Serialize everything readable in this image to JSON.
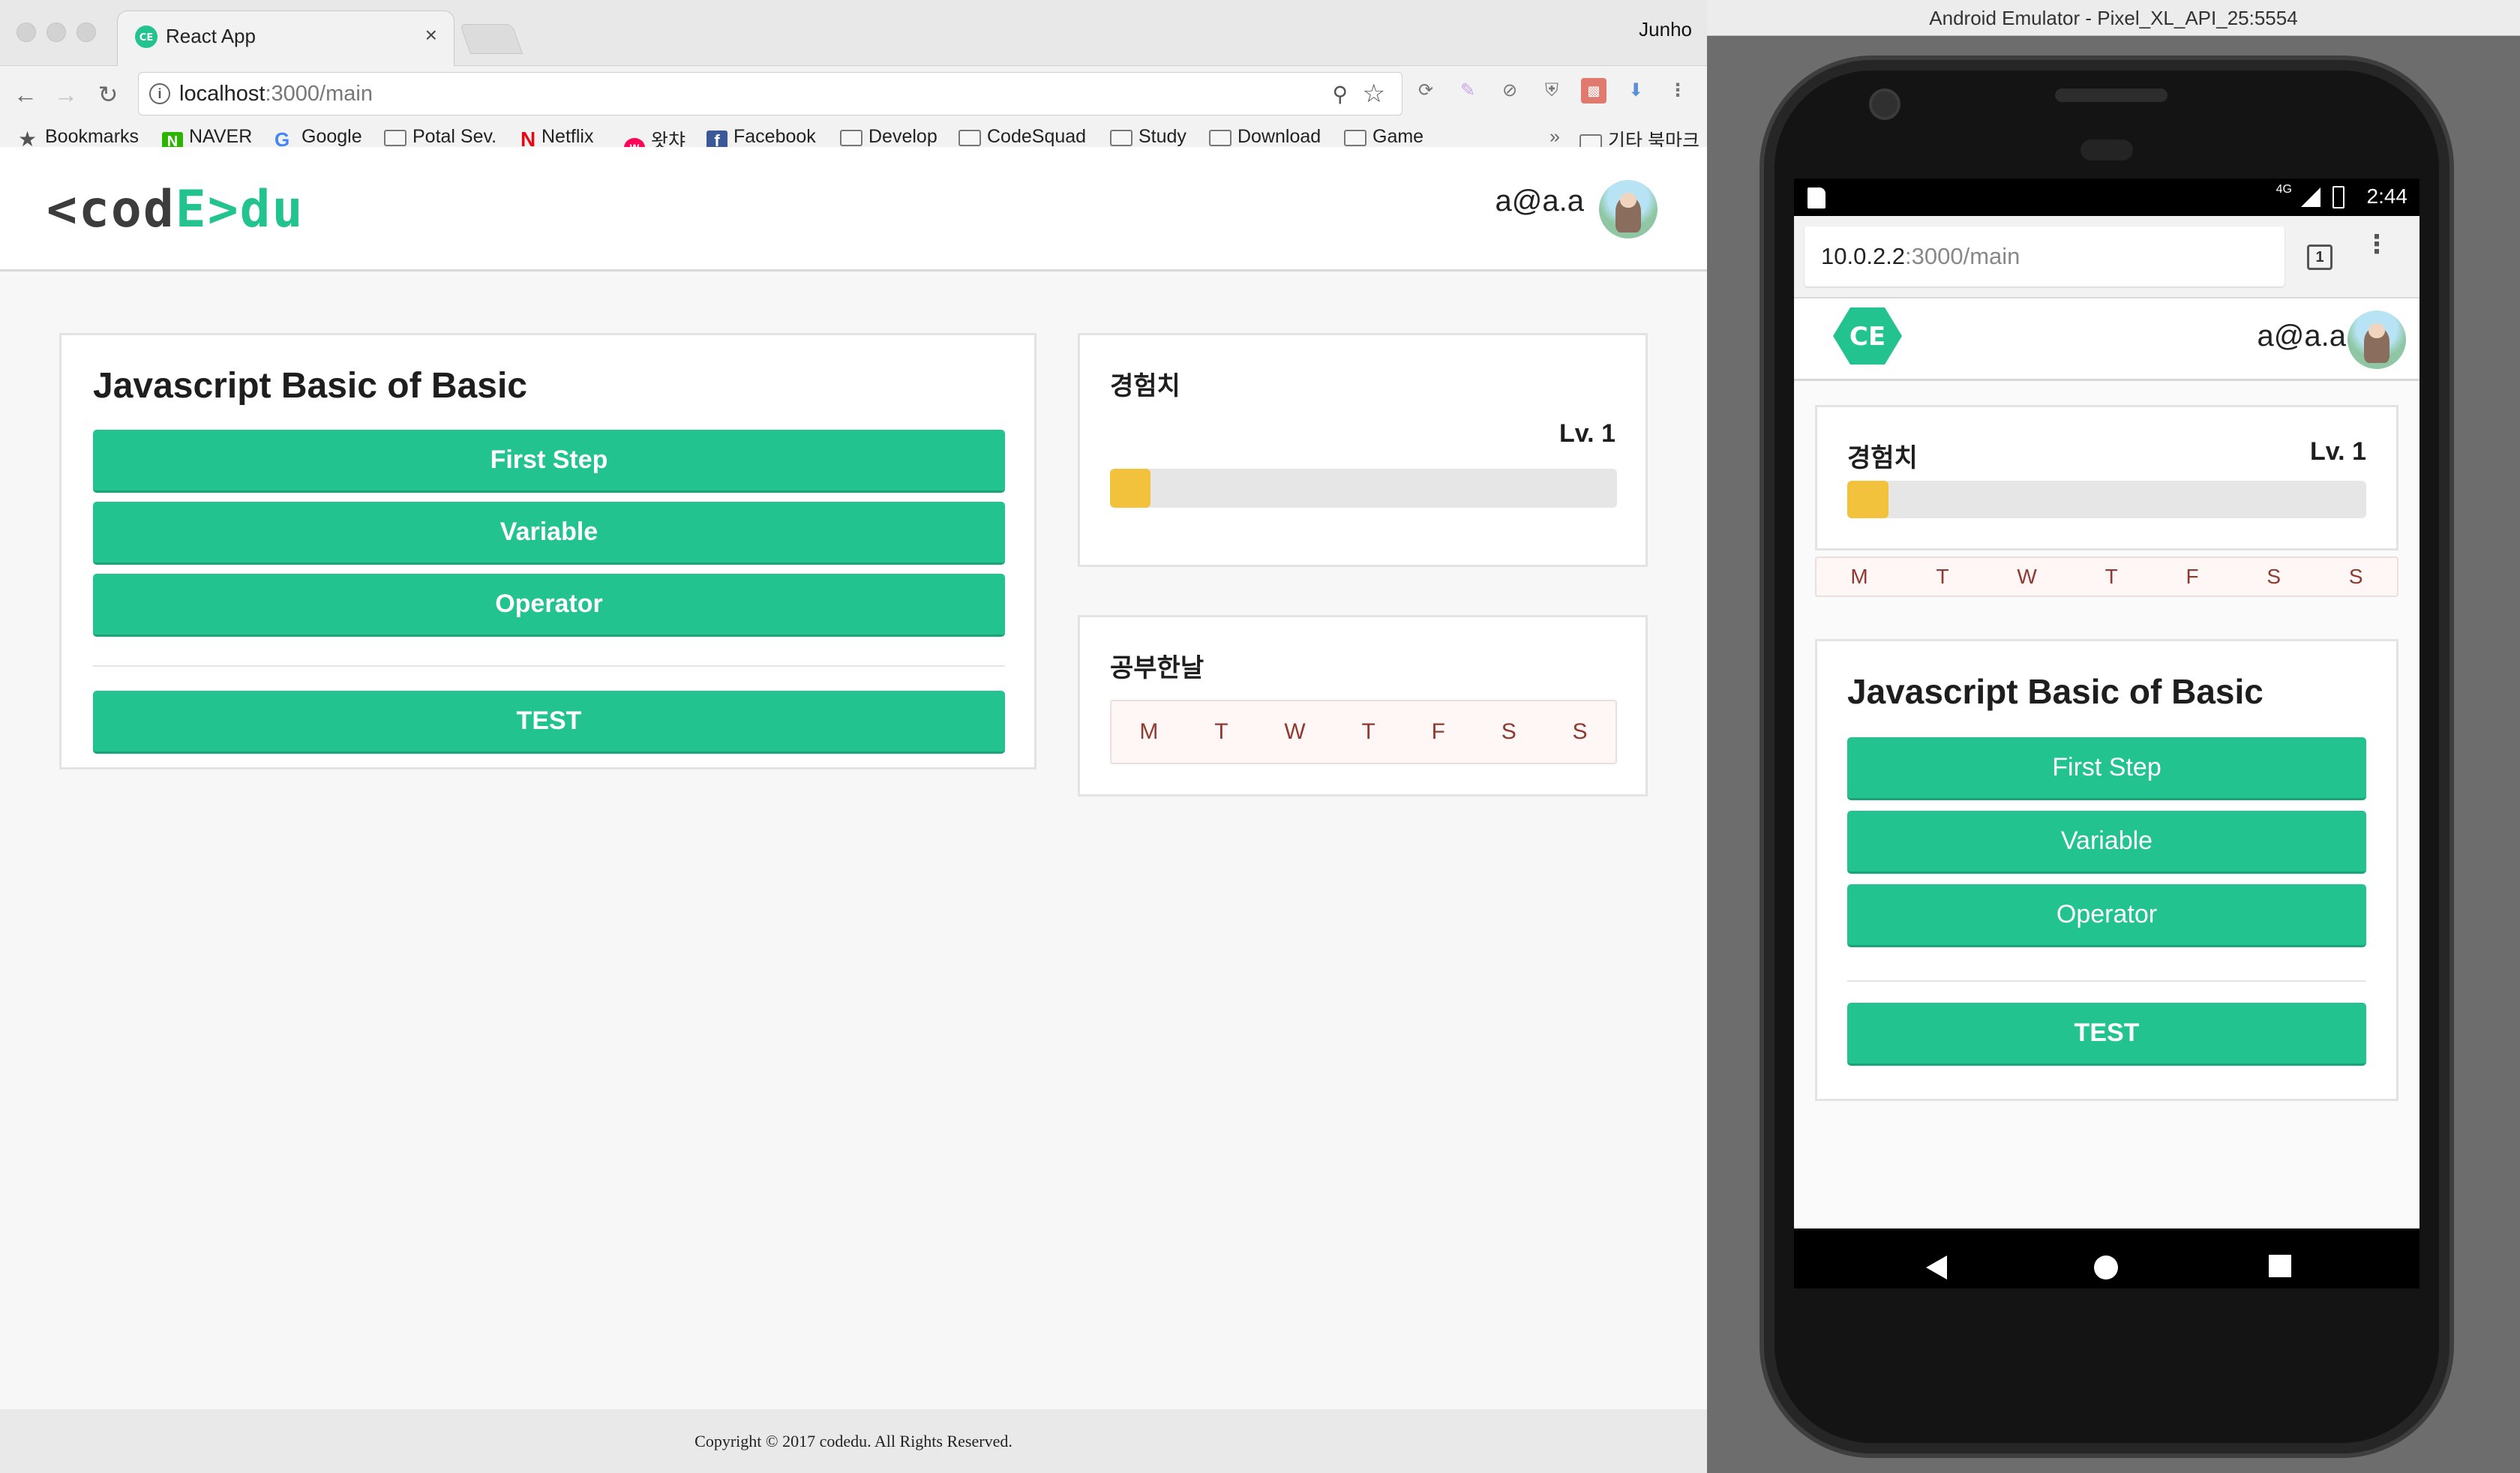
{
  "browser": {
    "tab_title": "React App",
    "tab_close": "×",
    "profile": "Junho",
    "url_host": "localhost",
    "url_path": ":3000/main",
    "bookmarks": [
      "Bookmarks",
      "NAVER",
      "Google",
      "Potal Sev.",
      "Netflix",
      "왓챠",
      "Facebook",
      "Develop",
      "CodeSquad",
      "Study",
      "Download",
      "Game"
    ],
    "more": "»",
    "other_bookmarks": "기타 북마크"
  },
  "site": {
    "logo_a": "<cod",
    "logo_b": "E>",
    "logo_c": "du",
    "user_email": "a@a.a",
    "course": {
      "title": "Javascript Basic of Basic",
      "steps": [
        "First Step",
        "Variable",
        "Operator"
      ],
      "test": "TEST"
    },
    "exp": {
      "label": "경험치",
      "level": "Lv. 1",
      "progress": 0.08,
      "fill_color": "#f2c23d"
    },
    "study_days": {
      "label": "공부한날",
      "days": [
        "M",
        "T",
        "W",
        "T",
        "F",
        "S",
        "S"
      ]
    },
    "footer": "Copyright © 2017 codedu. All Rights Reserved.",
    "accent": "#22c38f"
  },
  "emulator": {
    "title": "Android Emulator - Pixel_XL_API_25:5554",
    "time": "2:44",
    "net": "4G",
    "url_host": "10.0.2.2",
    "url_path": ":3000/main",
    "tab_count": "1",
    "logo_text": "CE"
  }
}
